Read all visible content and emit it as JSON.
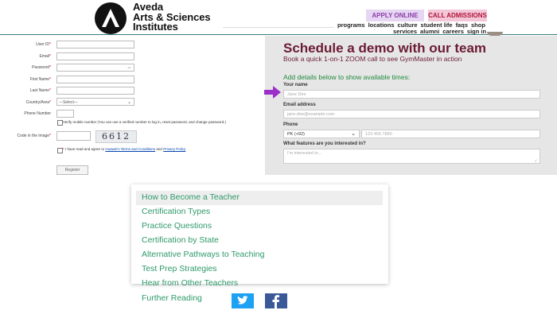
{
  "header": {
    "logo_lines": [
      "Aveda",
      "Arts & Sciences",
      "Institutes"
    ],
    "apply_label": "APPLY ONLINE",
    "call_label": "CALL ADMISSIONS",
    "nav_row1": [
      "programs",
      "locations",
      "culture",
      "student life",
      "faqs",
      "shop"
    ],
    "nav_row2": [
      "services",
      "alumni",
      "careers",
      "sign in"
    ]
  },
  "signup_form": {
    "fields": [
      {
        "label": "User ID",
        "value": ""
      },
      {
        "label": "Email",
        "value": ""
      },
      {
        "label": "Password",
        "value": ""
      },
      {
        "label": "First Name",
        "value": ""
      },
      {
        "label": "Last Name",
        "value": ""
      },
      {
        "label": "Country/Area",
        "value": "---Select---"
      }
    ],
    "phone_label": "Phone Number",
    "verify_text": "Verify mobile number (You can use a verified number to log in, reset password, and change password.)",
    "captcha_label": "Code in the image",
    "captcha_text": "6612",
    "terms_prefix": "I have read and agree to",
    "terms_link": "Huawei's Terms and Conditions",
    "terms_and": "and",
    "privacy_link": "Privacy Policy",
    "register_label": "Register"
  },
  "demo": {
    "title": "Schedule a demo with our team",
    "subtitle": "Book a quick 1-on-1 ZOOM call to see GymMaster in action",
    "add_details": "Add details below to show available times:",
    "name_label": "Your name",
    "name_placeholder": "Jane Doe",
    "email_label": "Email address",
    "email_placeholder": "jane.doe@example.com",
    "phone_label": "Phone",
    "phone_country": "PK (+92)",
    "phone_placeholder": "123 456 7890",
    "features_label": "What features are you interested in?",
    "features_placeholder": "I'm interested in..."
  },
  "menu": {
    "items": [
      "How to Become a Teacher",
      "Certification Types",
      "Practice Questions",
      "Certification by State",
      "Alternative Pathways to Teaching",
      "Test Prep Strategies",
      "Hear from Other Teachers",
      "Further Reading"
    ]
  },
  "social": {
    "twitter_icon": "twitter-icon",
    "facebook_icon": "facebook-icon",
    "twitter_color": "#1da1f2",
    "facebook_color": "#3b5998"
  }
}
